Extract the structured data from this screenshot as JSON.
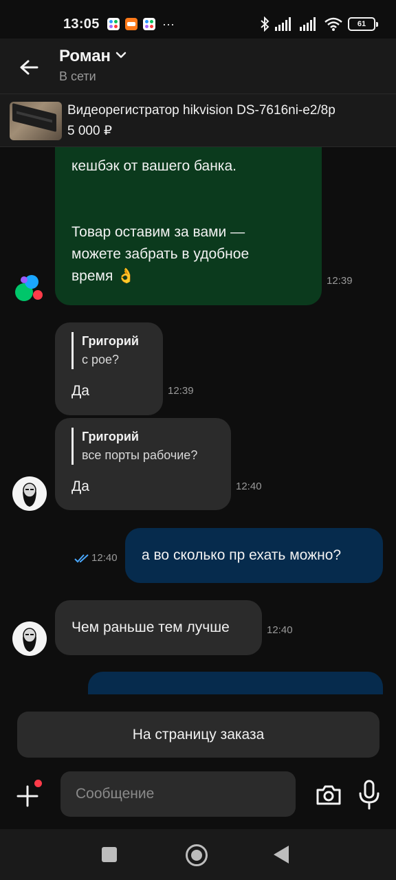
{
  "status_bar": {
    "time": "13:05",
    "battery": "61",
    "icons": [
      "app-notification-icon",
      "app-notification-icon",
      "app-notification-icon",
      "more-dots-icon",
      "bluetooth-icon",
      "signal-icon",
      "signal-icon",
      "wifi-icon",
      "battery-icon"
    ]
  },
  "header": {
    "contact_name": "Роман",
    "contact_status": "В сети"
  },
  "product": {
    "title": "Видеорегистратор hikvision DS-7616ni-e2/8p",
    "price": "5 000 ₽"
  },
  "messages": [
    {
      "type": "incoming",
      "author": "bot",
      "lines": [
        "кешбэк от вашего банка.",
        "",
        "",
        "Товар оставим за вами —",
        "можете забрать в удобное",
        "время 👌"
      ],
      "time": "12:39"
    },
    {
      "type": "incoming",
      "reply_author": "Григорий",
      "reply_text": "с рое?",
      "text": "Да",
      "time": "12:39"
    },
    {
      "type": "incoming",
      "reply_author": "Григорий",
      "reply_text": "все порты рабочие?",
      "text": "Да",
      "time": "12:40"
    },
    {
      "type": "outgoing",
      "text": "а во сколько пр ехать можно?",
      "time": "12:40",
      "read": true
    },
    {
      "type": "incoming",
      "text": "Чем раньше тем лучше",
      "time": "12:40"
    }
  ],
  "actions": {
    "order_button": "На страницу заказа"
  },
  "composer": {
    "placeholder": "Сообщение"
  },
  "colors": {
    "background": "#0e0e0e",
    "incoming_bubble": "#2b2b2b",
    "bot_bubble": "#0b3a1d",
    "outgoing_bubble": "#062b4d",
    "read_check": "#4aa8ff"
  }
}
